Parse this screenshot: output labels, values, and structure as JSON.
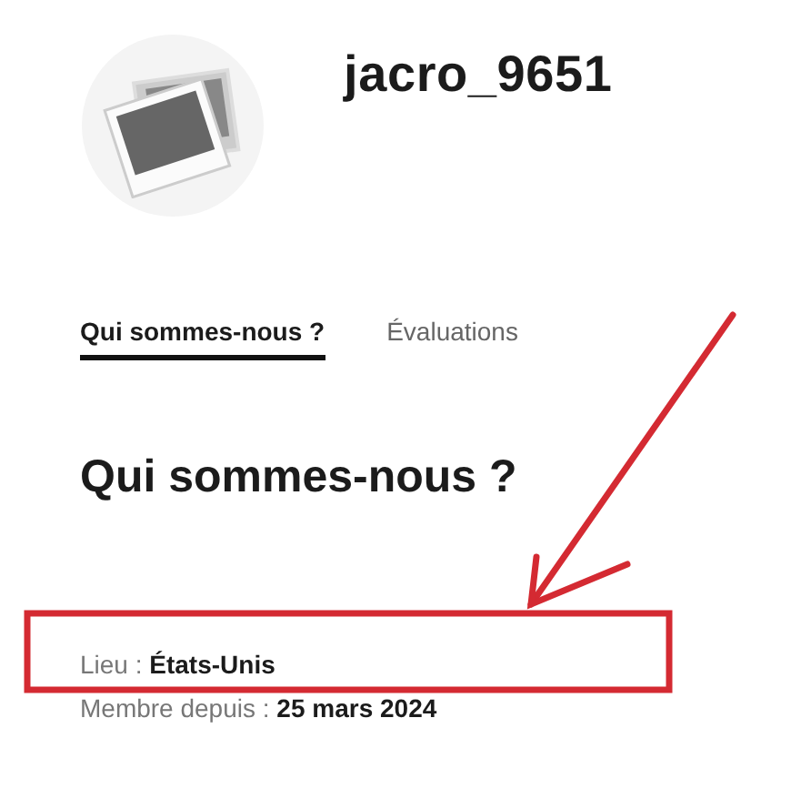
{
  "profile": {
    "username": "jacro_9651"
  },
  "tabs": [
    {
      "label": "Qui sommes-nous ?",
      "selected": true
    },
    {
      "label": "Évaluations",
      "selected": false
    }
  ],
  "section": {
    "title": "Qui sommes-nous ?",
    "details": [
      "Lieu : **États-Unis**",
      "Membre depuis : **25 mars 2024**"
    ]
  }
}
